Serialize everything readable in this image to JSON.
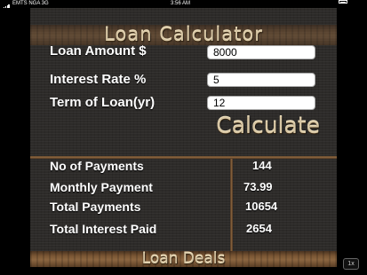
{
  "status_bar": {
    "carrier": "EMTS NGA  3G",
    "time": "3:56 AM",
    "battery_icon": "battery-icon",
    "signal_icon": "signal-bars-icon"
  },
  "app": {
    "title": "Loan Calculator",
    "inputs": {
      "loan_amount": {
        "label": "Loan Amount $",
        "value": "8000"
      },
      "interest_rate": {
        "label": "Interest Rate %",
        "value": "5"
      },
      "term": {
        "label": "Term of Loan(yr)",
        "value": "12"
      }
    },
    "calculate_label": "Calculate",
    "results": {
      "num_payments": {
        "label": "No of Payments",
        "value": "144"
      },
      "monthly_payment": {
        "label": "Monthly Payment",
        "value": "73.99"
      },
      "total_payments": {
        "label": "Total Payments",
        "value": "10654"
      },
      "total_interest": {
        "label": "Total Interest Paid",
        "value": "2654"
      }
    },
    "deals_label": "Loan Deals",
    "colors": {
      "background": "#2d2b29",
      "wood": "#8c6640",
      "carved_text": "#d8c7a5"
    }
  },
  "zoom_badge": "1x"
}
